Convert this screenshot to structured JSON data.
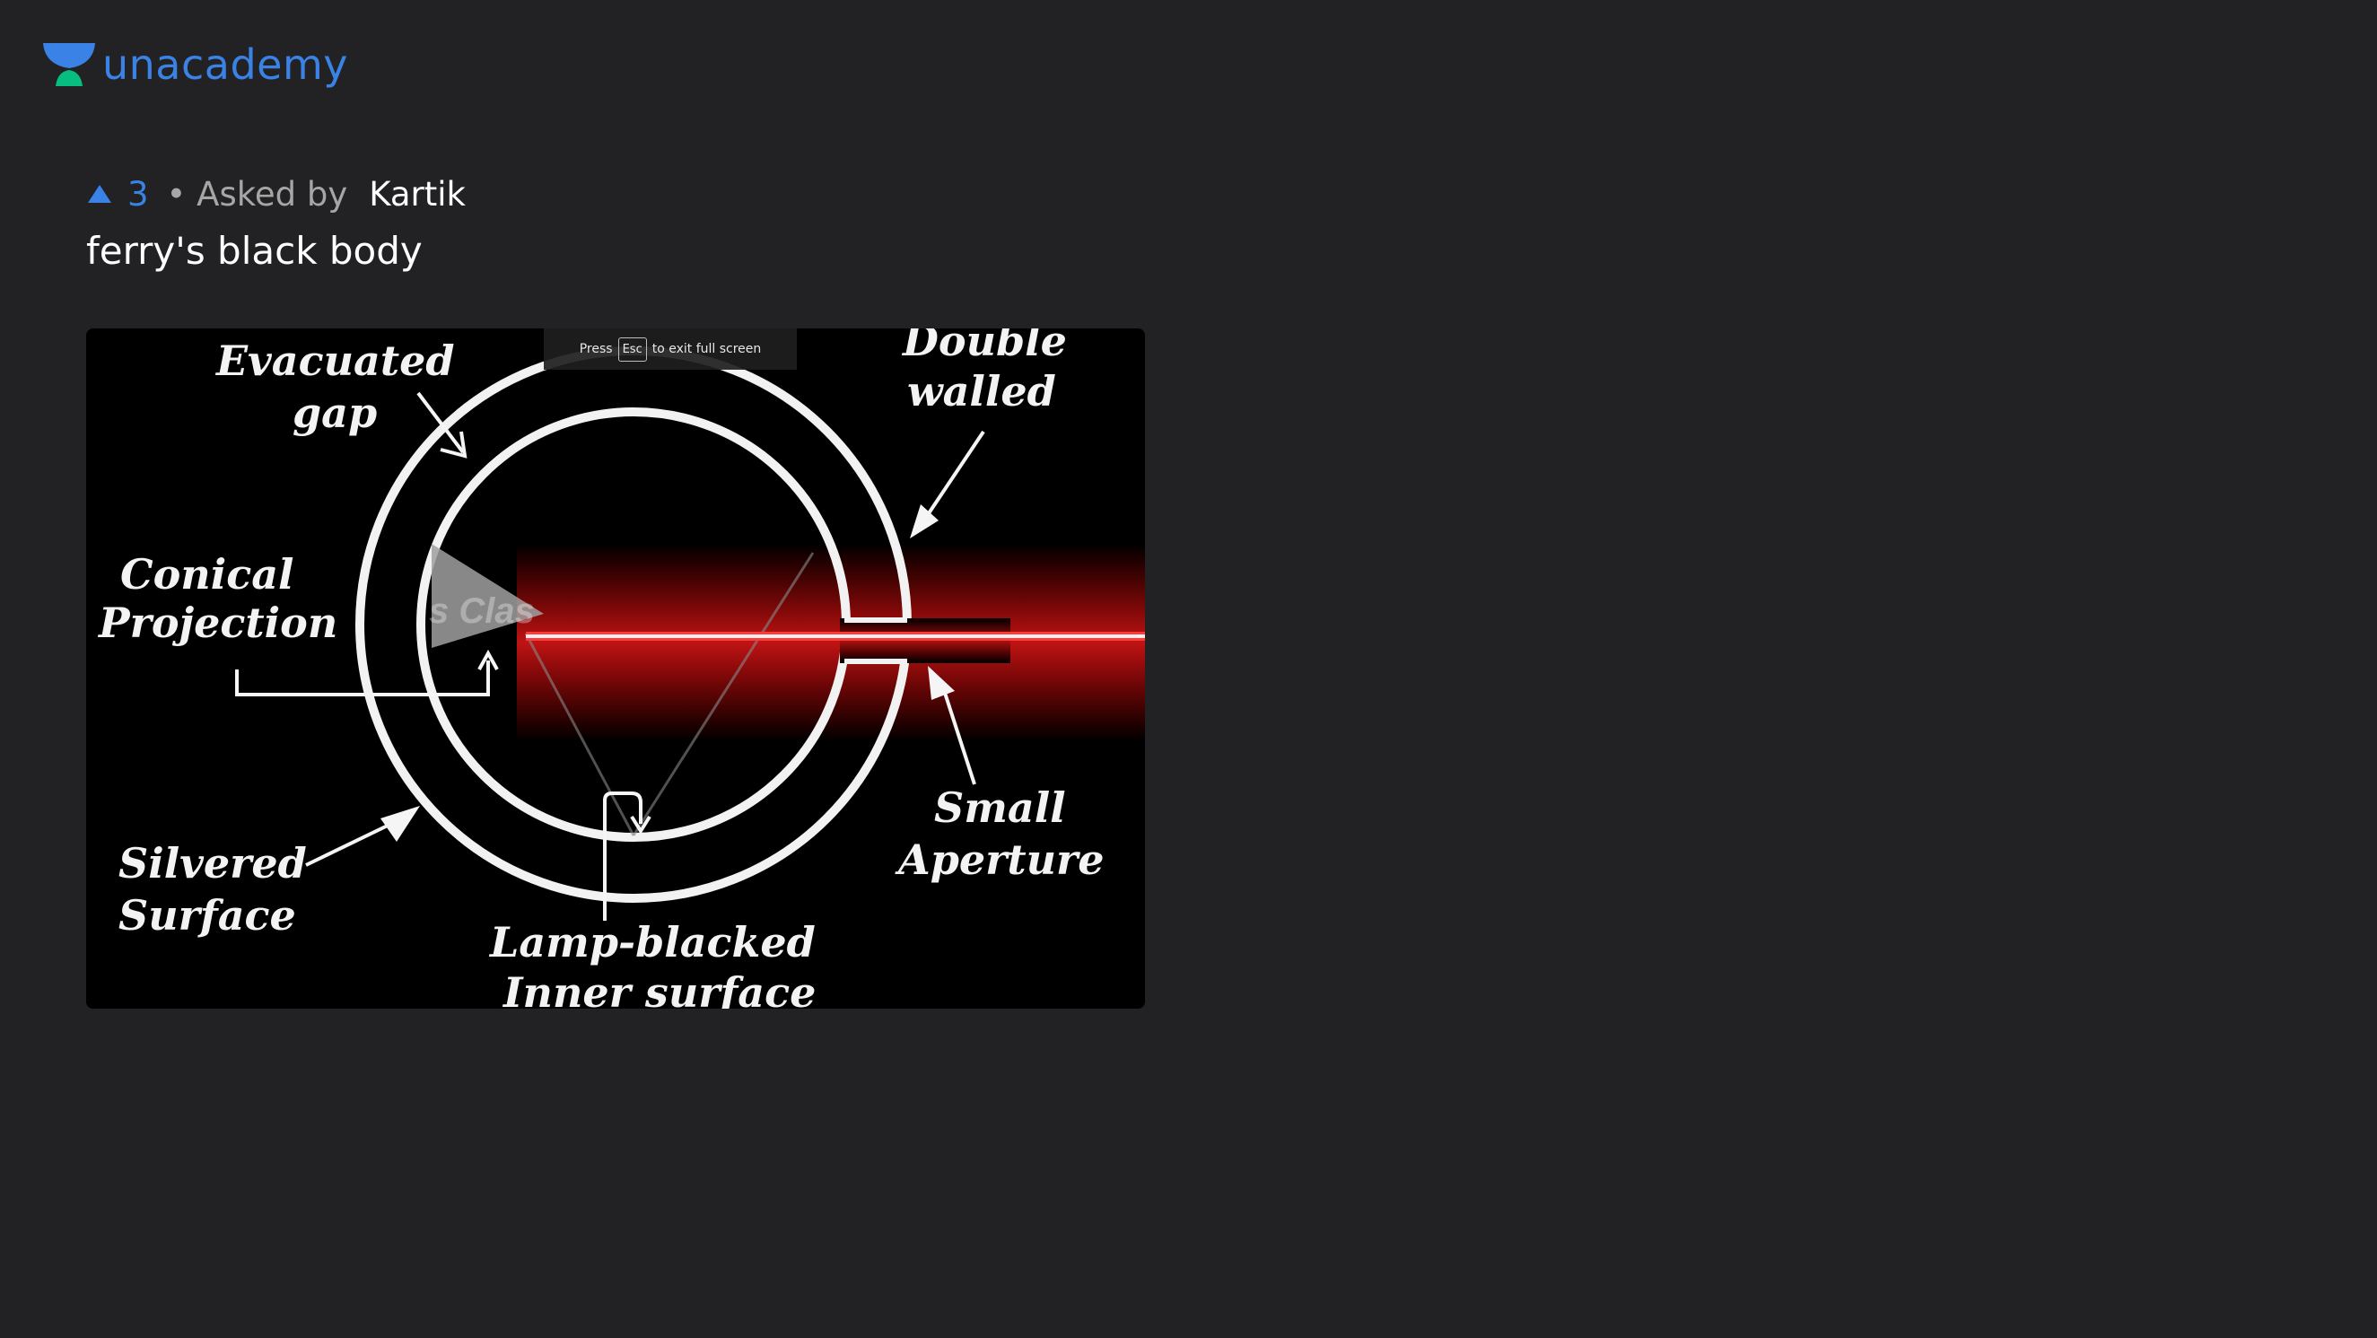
{
  "brand": {
    "name": "unacademy",
    "accent": "#3b82e6",
    "green": "#08bd80"
  },
  "question": {
    "upvotes": "3",
    "asked_prefix": "• Asked by",
    "author": "Kartik",
    "title": "ferry's black body"
  },
  "fullscreen_hint": {
    "press": "Press",
    "key": "Esc",
    "suffix": "to exit full screen"
  },
  "diagram": {
    "labels": {
      "evacuated_1": "Evacuated",
      "evacuated_2": "gap",
      "double_1": "Double",
      "double_2": "walled",
      "conical_1": "Conical",
      "conical_2": "Projection",
      "silvered_1": "Silvered",
      "silvered_2": "Surface",
      "small_1": "Small",
      "small_2": "Aperture",
      "lamp_1": "Lamp-blacked",
      "lamp_2": "Inner surface",
      "watermark": "s Clas"
    },
    "beam_color": "#ff2020"
  }
}
